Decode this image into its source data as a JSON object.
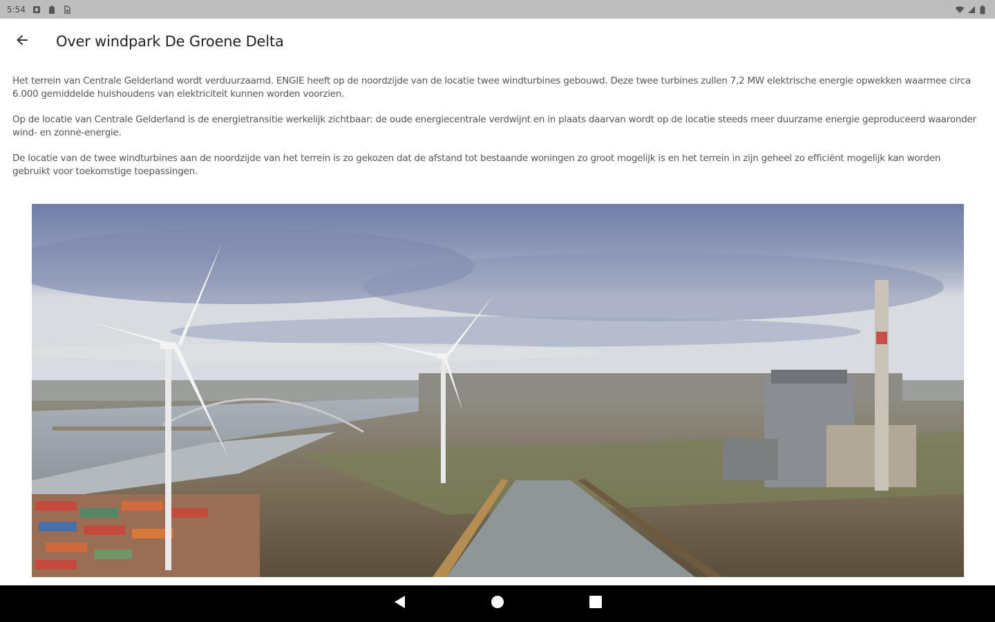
{
  "status_bar": {
    "time": "5:54",
    "icons": [
      "notification-d-icon",
      "clipboard-icon",
      "sim-icon",
      "wifi-icon",
      "signal-icon",
      "battery-icon"
    ]
  },
  "app_bar": {
    "back_icon": "arrow-back-icon",
    "title": "Over windpark De Groene Delta"
  },
  "content": {
    "paragraphs": [
      "Het terrein van Centrale Gelderland wordt verduurzaamd. ENGIE heeft op de noordzijde van de locatie twee windturbines gebouwd. Deze twee turbines zullen 7,2 MW elektrische energie opwekken waarmee circa 6.000 gemiddelde huishoudens van elektriciteit kunnen worden voorzien.",
      "Op de locatie van Centrale Gelderland is de energietransitie werkelijk zichtbaar: de oude energiecentrale verdwijnt en in plaats daarvan wordt op de locatie steeds meer duurzame energie geproduceerd waaronder wind- en zonne-energie.",
      "De locatie van de twee windturbines aan de noordzijde van het terrein is zo gekozen dat de afstand tot bestaande woningen zo groot mogelijk is en het terrein in zijn geheel zo efficiënt mogelijk kan worden gebruikt voor toekomstige toepassingen."
    ]
  },
  "photo": {
    "subject": "aerial-photo-wind-turbines-power-plant"
  },
  "nav_bar": {
    "icons": [
      "nav-back-icon",
      "nav-home-icon",
      "nav-recents-icon"
    ]
  }
}
